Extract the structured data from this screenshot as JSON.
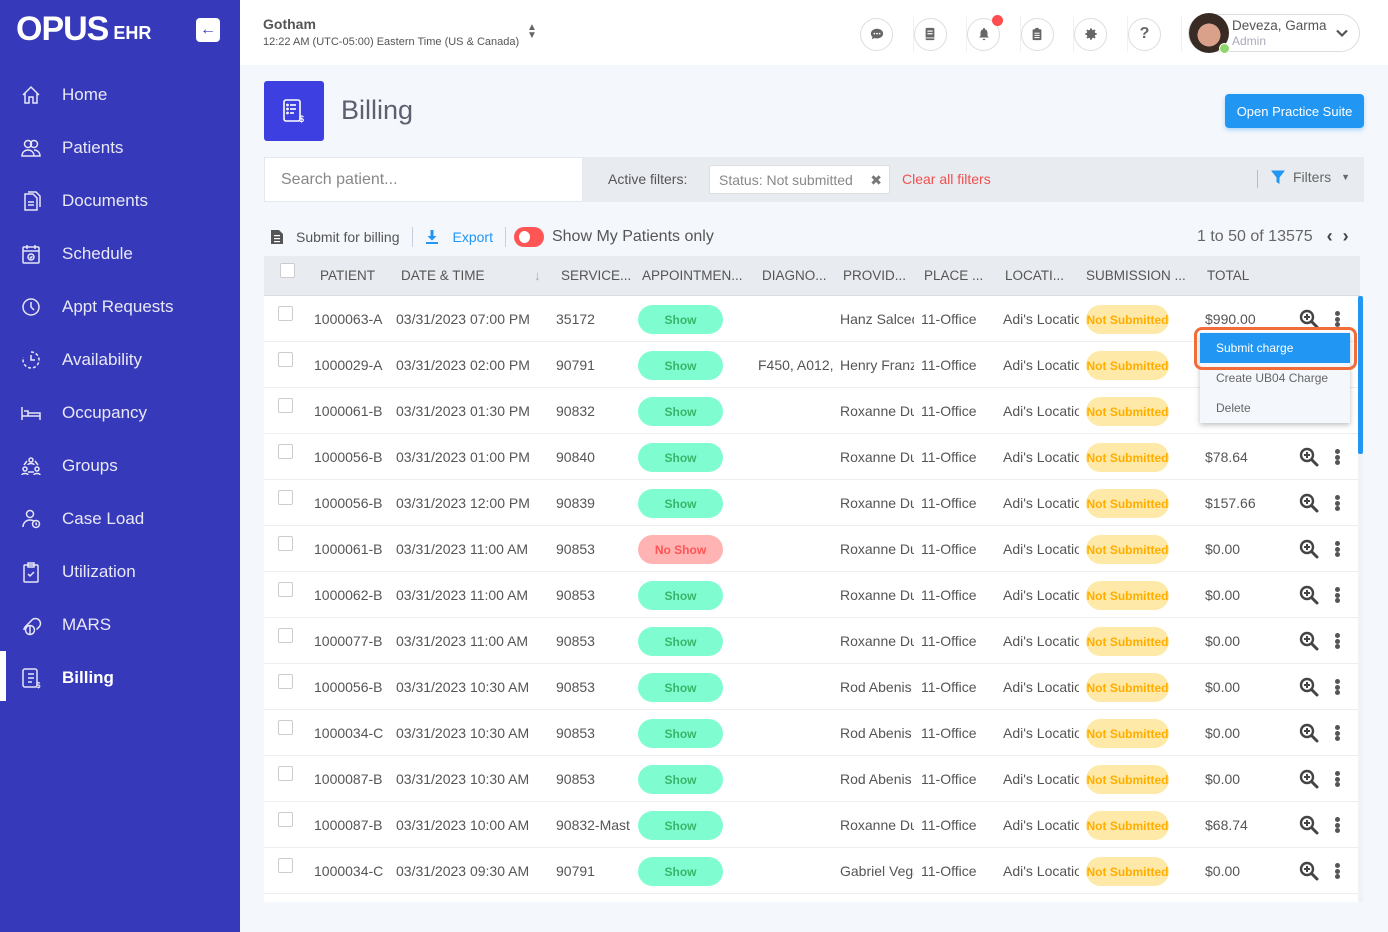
{
  "app": {
    "logo_main": "OPUS",
    "logo_sub": "EHR",
    "collapse_icon": "arrow-left-icon"
  },
  "sidebar": {
    "items": [
      {
        "label": "Home",
        "icon": "home-icon",
        "active": false
      },
      {
        "label": "Patients",
        "icon": "patients-icon",
        "active": false
      },
      {
        "label": "Documents",
        "icon": "documents-icon",
        "active": false
      },
      {
        "label": "Schedule",
        "icon": "calendar-icon",
        "active": false
      },
      {
        "label": "Appt Requests",
        "icon": "clock-icon",
        "active": false
      },
      {
        "label": "Availability",
        "icon": "availability-icon",
        "active": false
      },
      {
        "label": "Occupancy",
        "icon": "bed-icon",
        "active": false
      },
      {
        "label": "Groups",
        "icon": "groups-icon",
        "active": false
      },
      {
        "label": "Case Load",
        "icon": "case-load-icon",
        "active": false
      },
      {
        "label": "Utilization",
        "icon": "clipboard-check-icon",
        "active": false
      },
      {
        "label": "MARS",
        "icon": "pills-icon",
        "active": false
      },
      {
        "label": "Billing",
        "icon": "billing-icon",
        "active": true
      }
    ]
  },
  "topbar": {
    "org_name": "Gotham",
    "org_time": "12:22 AM (UTC-05:00) Eastern Time (US & Canada)",
    "icons": [
      "chat-icon",
      "book-icon",
      "bell-icon",
      "clipboard-icon",
      "gear-icon",
      "help-icon"
    ],
    "user": {
      "name": "Deveza, Garma",
      "role": "Admin",
      "status": "online"
    }
  },
  "page": {
    "title": "Billing",
    "open_suite_label": "Open Practice Suite"
  },
  "filters": {
    "search_placeholder": "Search patient...",
    "search_value": "",
    "active_label": "Active filters:",
    "chips": [
      "Status: Not submitted"
    ],
    "clear_label": "Clear all filters",
    "filters_label": "Filters"
  },
  "toolbar": {
    "submit_label": "Submit for billing",
    "export_label": "Export",
    "toggle_label": "Show My Patients only",
    "toggle_on": false,
    "pager_text": "1 to 50 of 13575"
  },
  "table": {
    "columns": [
      "PATIENT",
      "DATE & TIME",
      "SERVICE...",
      "APPOINTMEN...",
      "DIAGNO...",
      "PROVID...",
      "PLACE ...",
      "LOCATI...",
      "SUBMISSION ...",
      "TOTAL"
    ],
    "rows": [
      {
        "patient": "1000063-A",
        "datetime": "03/31/2023 07:00 PM",
        "service": "35172",
        "appointment": "Show",
        "diagnosis": "",
        "provider": "Hanz Salcedo",
        "place": "11-Office",
        "location": "Adi's Location",
        "submission": "Not Submitted",
        "total": "$990.00"
      },
      {
        "patient": "1000029-A",
        "datetime": "03/31/2023 02:00 PM",
        "service": "90791",
        "appointment": "Show",
        "diagnosis": "F450, A012,",
        "provider": "Henry Franz",
        "place": "11-Office",
        "location": "Adi's Location",
        "submission": "Not Submitted",
        "total": ""
      },
      {
        "patient": "1000061-B",
        "datetime": "03/31/2023 01:30 PM",
        "service": "90832",
        "appointment": "Show",
        "diagnosis": "",
        "provider": "Roxanne Du",
        "place": "11-Office",
        "location": "Adi's Location",
        "submission": "Not Submitted",
        "total": ""
      },
      {
        "patient": "1000056-B",
        "datetime": "03/31/2023 01:00 PM",
        "service": "90840",
        "appointment": "Show",
        "diagnosis": "",
        "provider": "Roxanne Du",
        "place": "11-Office",
        "location": "Adi's Location",
        "submission": "Not Submitted",
        "total": "$78.64"
      },
      {
        "patient": "1000056-B",
        "datetime": "03/31/2023 12:00 PM",
        "service": "90839",
        "appointment": "Show",
        "diagnosis": "",
        "provider": "Roxanne Du",
        "place": "11-Office",
        "location": "Adi's Location",
        "submission": "Not Submitted",
        "total": "$157.66"
      },
      {
        "patient": "1000061-B",
        "datetime": "03/31/2023 11:00 AM",
        "service": "90853",
        "appointment": "No Show",
        "diagnosis": "",
        "provider": "Roxanne Du",
        "place": "11-Office",
        "location": "Adi's Location",
        "submission": "Not Submitted",
        "total": "$0.00"
      },
      {
        "patient": "1000062-B",
        "datetime": "03/31/2023 11:00 AM",
        "service": "90853",
        "appointment": "Show",
        "diagnosis": "",
        "provider": "Roxanne Du",
        "place": "11-Office",
        "location": "Adi's Location",
        "submission": "Not Submitted",
        "total": "$0.00"
      },
      {
        "patient": "1000077-B",
        "datetime": "03/31/2023 11:00 AM",
        "service": "90853",
        "appointment": "Show",
        "diagnosis": "",
        "provider": "Roxanne Du",
        "place": "11-Office",
        "location": "Adi's Location",
        "submission": "Not Submitted",
        "total": "$0.00"
      },
      {
        "patient": "1000056-B",
        "datetime": "03/31/2023 10:30 AM",
        "service": "90853",
        "appointment": "Show",
        "diagnosis": "",
        "provider": "Rod Abenis",
        "place": "11-Office",
        "location": "Adi's Location",
        "submission": "Not Submitted",
        "total": "$0.00"
      },
      {
        "patient": "1000034-C",
        "datetime": "03/31/2023 10:30 AM",
        "service": "90853",
        "appointment": "Show",
        "diagnosis": "",
        "provider": "Rod Abenis",
        "place": "11-Office",
        "location": "Adi's Location",
        "submission": "Not Submitted",
        "total": "$0.00"
      },
      {
        "patient": "1000087-B",
        "datetime": "03/31/2023 10:30 AM",
        "service": "90853",
        "appointment": "Show",
        "diagnosis": "",
        "provider": "Rod Abenis",
        "place": "11-Office",
        "location": "Adi's Location",
        "submission": "Not Submitted",
        "total": "$0.00"
      },
      {
        "patient": "1000087-B",
        "datetime": "03/31/2023 10:00 AM",
        "service": "90832-Mast",
        "appointment": "Show",
        "diagnosis": "",
        "provider": "Roxanne Du",
        "place": "11-Office",
        "location": "Adi's Location",
        "submission": "Not Submitted",
        "total": "$68.74"
      },
      {
        "patient": "1000034-C",
        "datetime": "03/31/2023 09:30 AM",
        "service": "90791",
        "appointment": "Show",
        "diagnosis": "",
        "provider": "Gabriel Vega",
        "place": "11-Office",
        "location": "Adi's Location",
        "submission": "Not Submitted",
        "total": "$0.00"
      }
    ]
  },
  "context_menu": {
    "items": [
      "Submit charge",
      "Create UB04 Charge",
      "Delete"
    ],
    "highlighted": "Submit charge"
  },
  "colors": {
    "sidebar": "#3639b9",
    "accent": "#2196f3",
    "danger": "#f0504f",
    "show_bg": "#80fdd0",
    "noshow_bg": "#ffb3b3",
    "pending_bg": "#ffe9a8"
  }
}
